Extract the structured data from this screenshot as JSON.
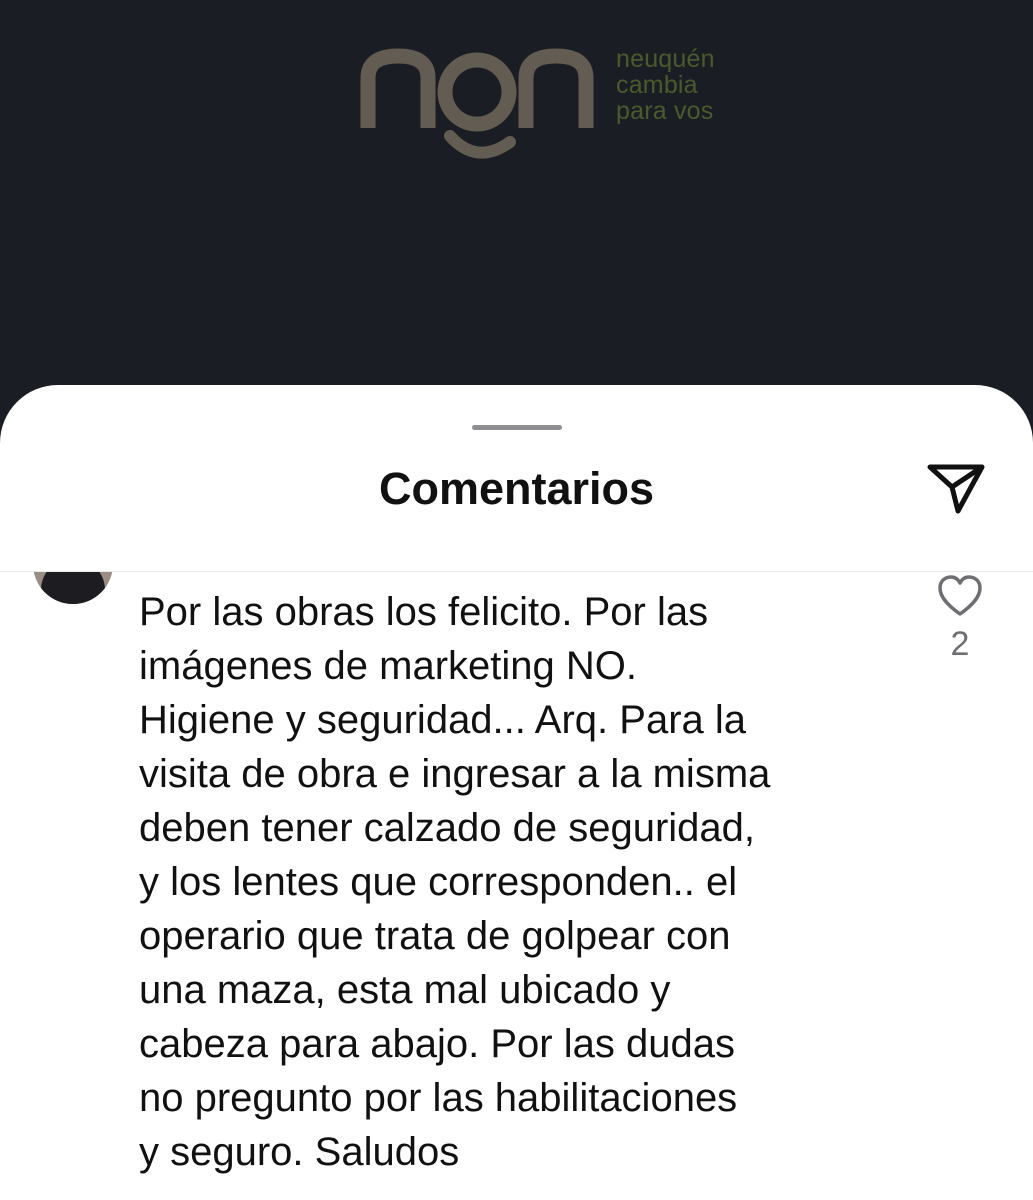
{
  "header_banner": {
    "logo_text": "non",
    "tagline": [
      "neuquén",
      "cambia",
      "para vos"
    ],
    "logo_color": "#625c52",
    "tagline_color": "#4a5a2c",
    "background_color": "#1a1e24"
  },
  "comments_sheet": {
    "title": "Comentarios",
    "share_icon": "paper-plane-icon"
  },
  "comment": {
    "text": "Por las obras los felicito. Por las\nimágenes de marketing NO.\nHigiene y seguridad... Arq. Para la\nvisita de obra e ingresar a la misma\ndeben tener calzado de seguridad,\ny los lentes que corresponden.. el\noperario que trata de golpear con\nuna maza, esta mal ubicado y\ncabeza para abajo. Por las dudas\nno pregunto por las habilitaciones\ny seguro. Saludos",
    "like_icon": "heart-icon",
    "like_count": "2"
  }
}
